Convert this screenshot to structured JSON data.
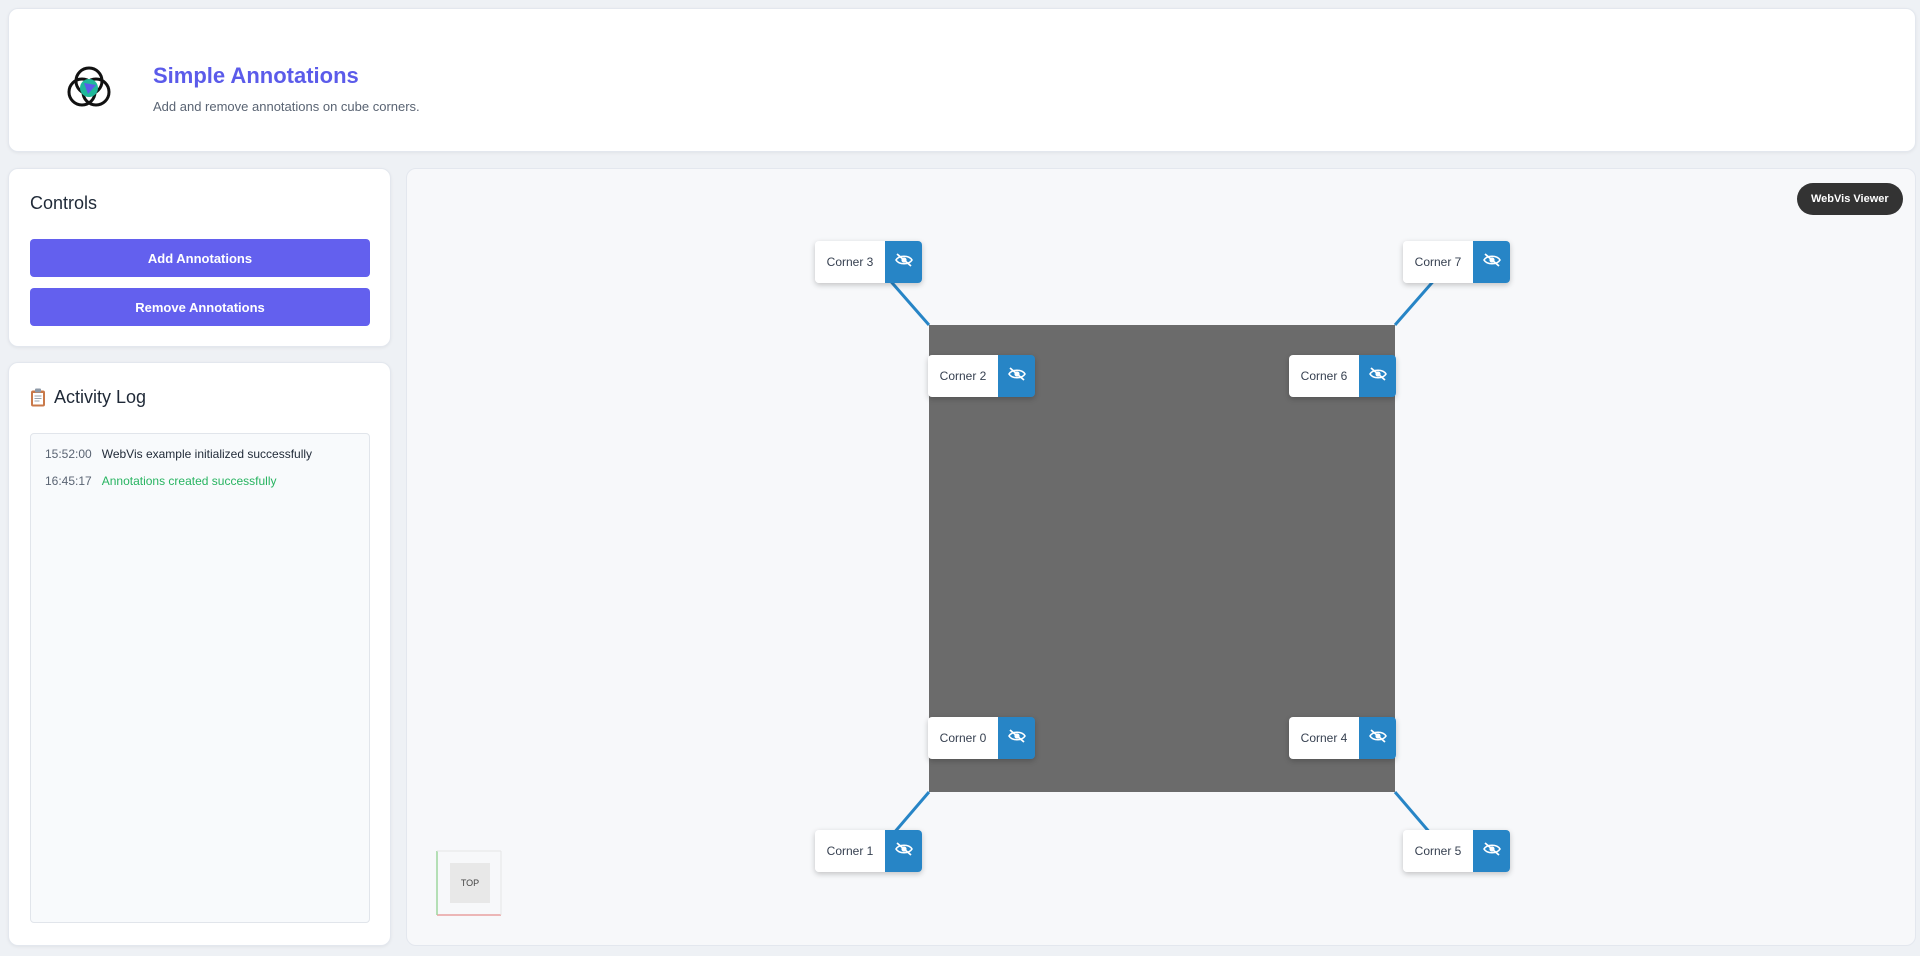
{
  "header": {
    "title": "Simple Annotations",
    "subtitle": "Add and remove annotations on cube corners.",
    "logo_icon": "webvis-logo-icon"
  },
  "controls": {
    "title": "Controls",
    "add_label": "Add Annotations",
    "remove_label": "Remove Annotations"
  },
  "log": {
    "title": "Activity Log",
    "icon": "clipboard-icon",
    "entries": [
      {
        "time": "15:52:00",
        "message": "WebVis example initialized successfully",
        "status": "info"
      },
      {
        "time": "16:45:17",
        "message": "Annotations created successfully",
        "status": "success"
      }
    ]
  },
  "viewer": {
    "badge": "WebVis Viewer",
    "cube_color": "#6b6b6b",
    "nav_cube_face": "TOP",
    "annotations": [
      {
        "label": "Corner 3",
        "toggle_icon": "eye-off-icon"
      },
      {
        "label": "Corner 7",
        "toggle_icon": "eye-off-icon"
      },
      {
        "label": "Corner 2",
        "toggle_icon": "eye-off-icon"
      },
      {
        "label": "Corner 6",
        "toggle_icon": "eye-off-icon"
      },
      {
        "label": "Corner 0",
        "toggle_icon": "eye-off-icon"
      },
      {
        "label": "Corner 4",
        "toggle_icon": "eye-off-icon"
      },
      {
        "label": "Corner 1",
        "toggle_icon": "eye-off-icon"
      },
      {
        "label": "Corner 5",
        "toggle_icon": "eye-off-icon"
      }
    ]
  },
  "colors": {
    "accent": "#6360ee",
    "title": "#5b5bea",
    "annotation_toggle": "#2785c6",
    "success": "#28b461",
    "badge": "#333333"
  }
}
